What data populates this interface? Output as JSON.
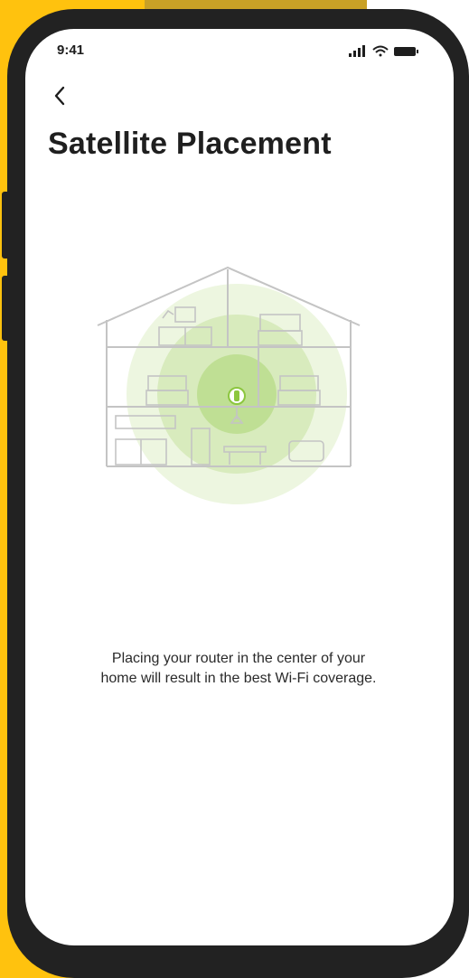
{
  "status_bar": {
    "time": "9:41",
    "icons": [
      "signal-icon",
      "wifi-icon",
      "battery-icon"
    ]
  },
  "header": {
    "back_icon": "chevron-left-icon",
    "title": "Satellite Placement"
  },
  "illustration": {
    "subject": "house-wifi-coverage",
    "accent_color": "#8cc63f",
    "line_color": "#c8c8c8"
  },
  "body": {
    "caption_line1": "Placing your router in the center of your",
    "caption_line2": "home will result in the best Wi-Fi coverage."
  },
  "colors": {
    "frame": "#222222",
    "background_accent": "#ffc20e"
  }
}
